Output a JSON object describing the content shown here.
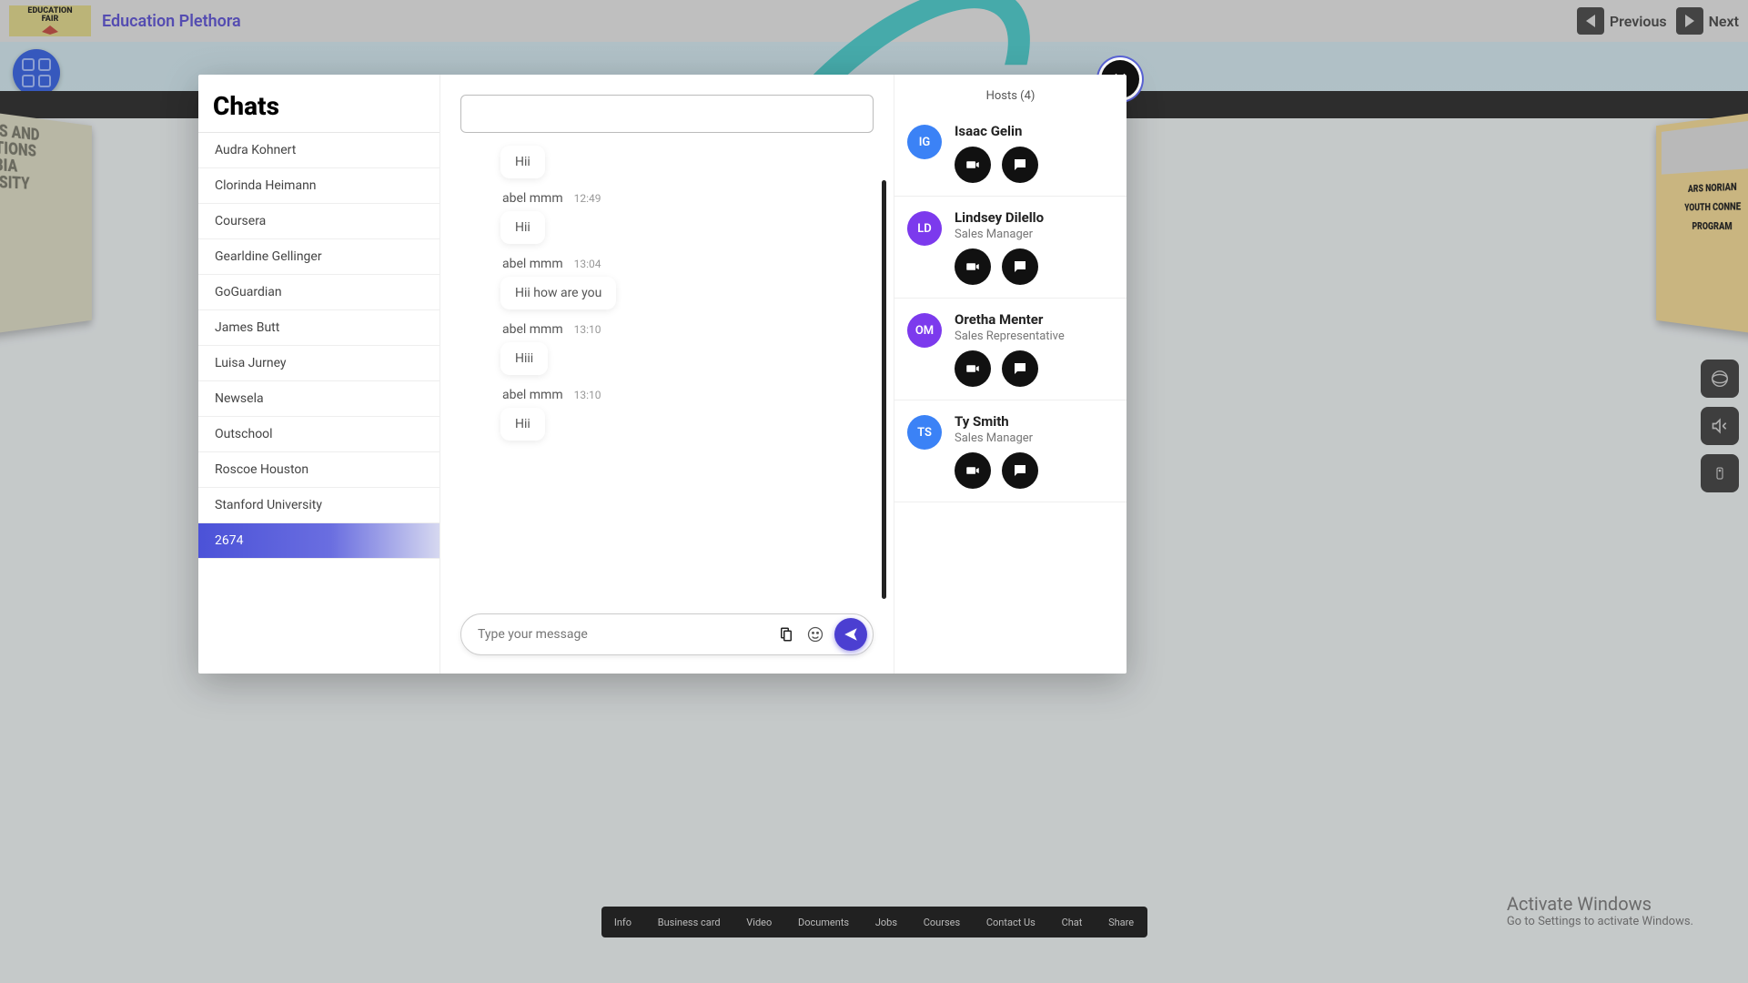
{
  "topbar": {
    "logo_line1": "EDUCATION",
    "logo_line2": "FAIR",
    "title": "Education Plethora",
    "prev": "Previous",
    "next": "Next"
  },
  "poster_left_text": "RES AND\nBITIONS\nMBIA\nERSITY",
  "poster_right_line1": "ARS NORIAN",
  "poster_right_line2": "YOUTH CONNE",
  "poster_right_line3": "PROGRAM",
  "bottom_tabs": [
    "Info",
    "Business card",
    "Video",
    "Documents",
    "Jobs",
    "Courses",
    "Contact Us",
    "Chat",
    "Share"
  ],
  "watermark": {
    "l1": "Activate Windows",
    "l2": "Go to Settings to activate Windows."
  },
  "chats_heading": "Chats",
  "conversations": [
    "Audra Kohnert",
    "Clorinda Heimann",
    "Coursera",
    "Gearldine Gellinger",
    "GoGuardian",
    "James Butt",
    "Luisa Jurney",
    "Newsela",
    "Outschool",
    "Roscoe Houston",
    "Stanford University",
    "2674"
  ],
  "active_conversation_index": 11,
  "thread": [
    {
      "sender": "",
      "time": "",
      "text": "Hii"
    },
    {
      "sender": "abel mmm",
      "time": "12:49",
      "text": "Hii"
    },
    {
      "sender": "abel mmm",
      "time": "13:04",
      "text": "Hii how are you"
    },
    {
      "sender": "abel mmm",
      "time": "13:10",
      "text": "Hiii"
    },
    {
      "sender": "abel mmm",
      "time": "13:10",
      "text": "Hii"
    }
  ],
  "composer_placeholder": "Type your message",
  "hosts_label": "Hosts (4)",
  "hosts": [
    {
      "initials": "IG",
      "color": "blue",
      "name": "Isaac Gelin",
      "role": ""
    },
    {
      "initials": "LD",
      "color": "purple",
      "name": "Lindsey Dilello",
      "role": "Sales Manager"
    },
    {
      "initials": "OM",
      "color": "purple",
      "name": "Oretha Menter",
      "role": "Sales Representative"
    },
    {
      "initials": "TS",
      "color": "blue",
      "name": "Ty Smith",
      "role": "Sales Manager"
    }
  ]
}
